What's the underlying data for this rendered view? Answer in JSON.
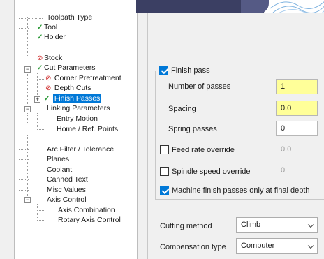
{
  "tree": {
    "items": [
      {
        "label": "Toolpath Type"
      },
      {
        "label": "Tool"
      },
      {
        "label": "Holder"
      },
      {
        "label": "Stock"
      },
      {
        "label": "Cut Parameters"
      },
      {
        "label": "Corner Pretreatment"
      },
      {
        "label": "Depth Cuts"
      },
      {
        "label": "Finish Passes"
      },
      {
        "label": "Linking Parameters"
      },
      {
        "label": "Entry Motion"
      },
      {
        "label": "Home / Ref. Points"
      },
      {
        "label": "Arc Filter / Tolerance"
      },
      {
        "label": "Planes"
      },
      {
        "label": "Coolant"
      },
      {
        "label": "Canned Text"
      },
      {
        "label": "Misc Values"
      },
      {
        "label": "Axis Control"
      },
      {
        "label": "Axis Combination"
      },
      {
        "label": "Rotary Axis Control"
      }
    ]
  },
  "finish_pass": {
    "title": "Finish pass",
    "checked": true,
    "number_of_passes_label": "Number of passes",
    "number_of_passes": "1",
    "spacing_label": "Spacing",
    "spacing": "0.0",
    "spring_passes_label": "Spring passes",
    "spring_passes": "0",
    "feed_rate_override_label": "Feed rate override",
    "feed_rate_override": "0.0",
    "spindle_speed_override_label": "Spindle speed override",
    "spindle_speed_override": "0",
    "final_depth_label": "Machine finish passes only at final depth"
  },
  "cutting_method": {
    "label": "Cutting method",
    "value": "Climb"
  },
  "compensation_type": {
    "label": "Compensation type",
    "value": "Computer"
  },
  "colors": {
    "selection": "#0078d7",
    "highlight_field": "#ffff99",
    "check_green": "#2e9b3a",
    "error_red": "#cc2020"
  }
}
